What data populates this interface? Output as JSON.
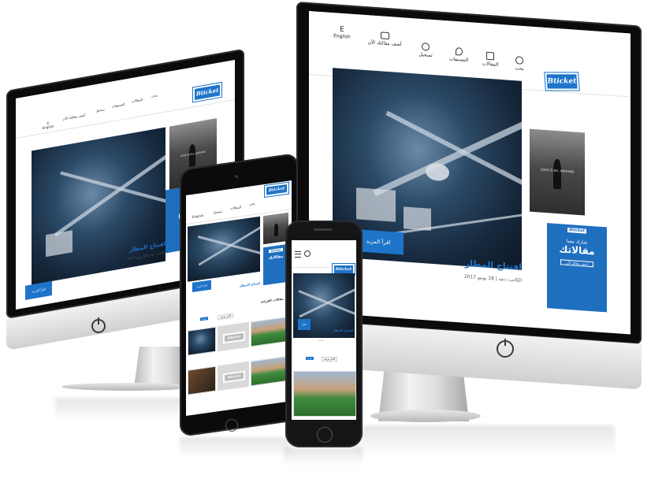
{
  "site": {
    "logo_text": "Bticket",
    "nav": {
      "search": "بحث",
      "articles": "المقالات",
      "location": "التصنيفات",
      "login": "تسجيل",
      "add_article": "أضف مقالتك الآن",
      "language_letter": "E",
      "language": "English"
    },
    "hero": {
      "title": "افتتاح المطار",
      "meta": "الكاتب: دمه | 18 يونيو 2017",
      "button": "اقرأ المزيد"
    },
    "ad": {
      "logo_text": "Bticket",
      "line1": "شارك معنا",
      "line2": "مقالاتك",
      "button": "أضف مقالك الآن"
    },
    "side_photo_caption": "LOVE IS ALL AROUND",
    "section_title": "مقالات القراءة",
    "tabs": [
      "الأكثر قراءة",
      "جديد"
    ]
  },
  "colors": {
    "brand_blue": "#1e74c9",
    "bezel": "#0b0b0c",
    "aluminum": "#d6d7d9"
  }
}
